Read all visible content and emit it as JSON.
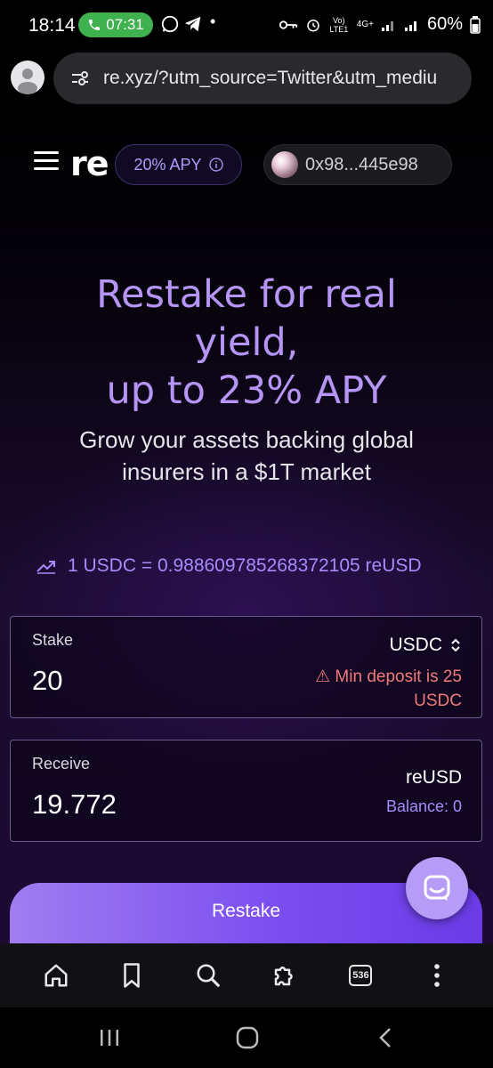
{
  "status_bar": {
    "time": "18:14",
    "call_timer": "07:31",
    "network_label": "Vo) LTE1",
    "network_type": "4G+",
    "battery": "60%"
  },
  "browser": {
    "url": "re.xyz/?utm_source=Twitter&utm_mediu",
    "tab_count": "536"
  },
  "header": {
    "logo": "re",
    "apy_badge": "20% APY",
    "wallet_address": "0x98...445e98"
  },
  "hero": {
    "title_line1": "Restake for real",
    "title_line2": "yield,",
    "title_line3": "up to 23% APY",
    "subtitle_line1": "Grow your assets backing global",
    "subtitle_line2": "insurers in a $1T market"
  },
  "rate": {
    "text": "1 USDC = 0.988609785268372105 reUSD"
  },
  "stake": {
    "label": "Stake",
    "value": "20",
    "token": "USDC",
    "warning_line1": "⚠ Min deposit is 25",
    "warning_line2": "USDC"
  },
  "receive": {
    "label": "Receive",
    "value": "19.772",
    "token": "reUSD",
    "balance": "Balance: 0"
  },
  "actions": {
    "restake_label": "Restake"
  },
  "colors": {
    "accent": "#b795f7",
    "button": "#7c4ff0",
    "warning": "#f07a7a"
  }
}
